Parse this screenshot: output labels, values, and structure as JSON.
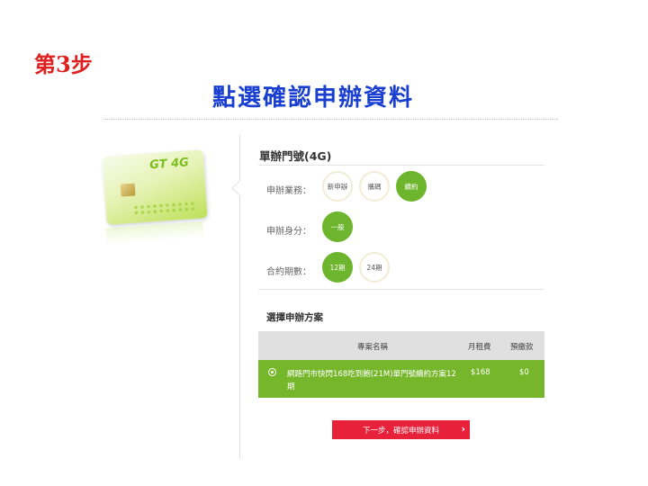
{
  "step_label": "第3步",
  "main_title": "點選確認申辦資料",
  "sim_card": {
    "logo_text": "GT 4G"
  },
  "section": {
    "title": "單辦門號(4G)"
  },
  "options": {
    "service": {
      "label": "申辦業務：",
      "items": [
        "新申辦",
        "攜碼",
        "續約"
      ],
      "selected": "續約"
    },
    "identity": {
      "label": "申辦身分：",
      "items": [
        "一般"
      ],
      "selected": "一般"
    },
    "contract": {
      "label": "合約期數：",
      "items": [
        "12期",
        "24期"
      ],
      "selected": "12期"
    }
  },
  "plan_section": {
    "title": "選擇申辦方案",
    "columns": [
      "專案名稱",
      "月租費",
      "預繳款"
    ],
    "rows": [
      {
        "name": "網路門市快閃168吃到飽(21M)單門號續約方案12期",
        "monthly": "$168",
        "prepay": "$0",
        "selected": true
      }
    ]
  },
  "next_button": {
    "label": "下一步，確認申辦資料",
    "icon": "chevron-right-icon"
  },
  "colors": {
    "accent_green": "#6cb52d",
    "button_red": "#e8213a",
    "title_blue": "#1a3fd0",
    "step_red": "#e0201f"
  }
}
